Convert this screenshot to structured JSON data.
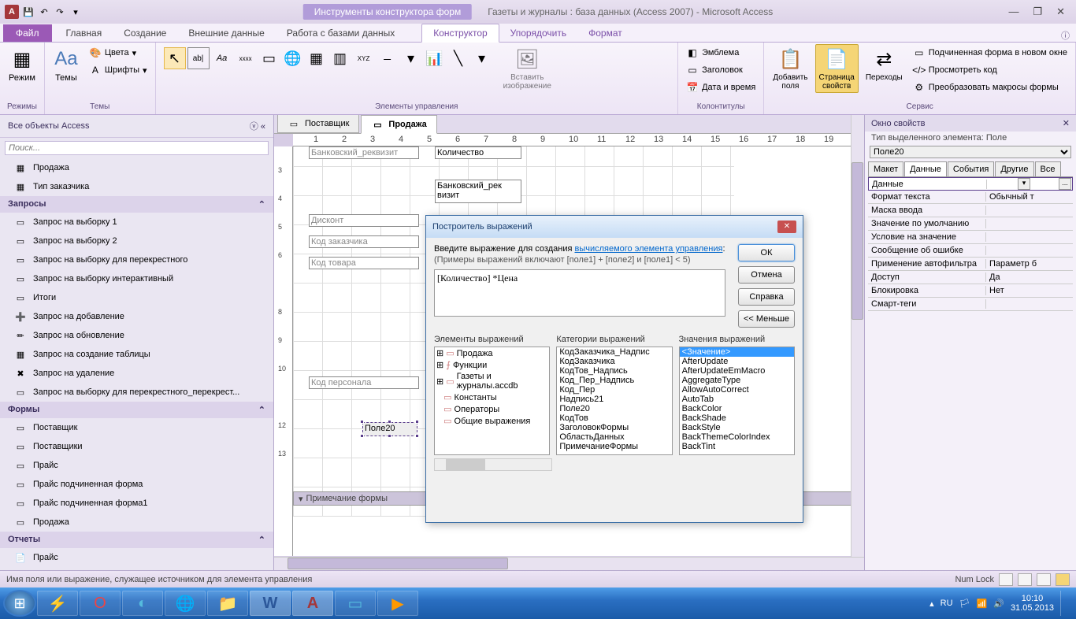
{
  "title_context": "Инструменты конструктора форм",
  "app_title": "Газеты и журналы : база данных (Access 2007)  -  Microsoft Access",
  "file_tab": "Файл",
  "ribbon_tabs": [
    "Главная",
    "Создание",
    "Внешние данные",
    "Работа с базами данных"
  ],
  "ribbon_ctx_tabs": [
    "Конструктор",
    "Упорядочить",
    "Формат"
  ],
  "ribbon_groups": {
    "modes": "Режимы",
    "themes": "Темы",
    "controls": "Элементы управления",
    "headers": "Колонтитулы",
    "tools": "Сервис"
  },
  "ribbon_btn": {
    "regime": "Режим",
    "themes": "Темы",
    "colors": "Цвета",
    "fonts": "Шрифты",
    "insert_img": "Вставить\nизображение",
    "emblem": "Эмблема",
    "title": "Заголовок",
    "datetime": "Дата и время",
    "add_fields": "Добавить\nполя",
    "prop_page": "Страница\nсвойств",
    "transitions": "Переходы",
    "subform": "Подчиненная форма в новом окне",
    "view_code": "Просмотреть код",
    "convert_macros": "Преобразовать макросы формы"
  },
  "nav_header": "Все объекты Access",
  "nav_search_ph": "Поиск...",
  "nav_tables": [
    "Продажа",
    "Тип заказчика"
  ],
  "nav_queries_h": "Запросы",
  "nav_queries": [
    "Запрос на выборку 1",
    "Запрос на выборку 2",
    "Запрос на выборку для перекрестного",
    "Запрос на выборку интерактивный",
    "Итоги",
    "Запрос на добавление",
    "Запрос на обновление",
    "Запрос на создание таблицы",
    "Запрос на удаление",
    "Запрос на выборку для перекрестного_перекрест..."
  ],
  "nav_forms_h": "Формы",
  "nav_forms": [
    "Поставщик",
    "Поставщики",
    "Прайс",
    "Прайс подчиненная форма",
    "Прайс подчиненная форма1",
    "Продажа"
  ],
  "nav_reports_h": "Отчеты",
  "nav_reports": [
    "Прайс"
  ],
  "doc_tabs": [
    "Поставщик",
    "Продажа"
  ],
  "design_fields": {
    "row1a": "Количество",
    "row1b": "Количество",
    "row2a": "Банковский_реквизит",
    "row2b": "Банковский_рек\nвизит",
    "row3a": "Дисконт",
    "row4a": "Код заказчика",
    "row5a": "Код товара",
    "row7a": "Код персонала",
    "sel": "Поле20",
    "footer": "Примечание формы"
  },
  "prop": {
    "title": "Окно свойств",
    "subtitle": "Тип выделенного элемента:  Поле",
    "combo": "Поле20",
    "tabs": [
      "Макет",
      "Данные",
      "События",
      "Другие",
      "Все"
    ],
    "rows": [
      {
        "n": "Данные",
        "v": "",
        "b": "..."
      },
      {
        "n": "Формат текста",
        "v": "Обычный т"
      },
      {
        "n": "Маска ввода",
        "v": ""
      },
      {
        "n": "Значение по умолчанию",
        "v": ""
      },
      {
        "n": "Условие на значение",
        "v": ""
      },
      {
        "n": "Сообщение об ошибке",
        "v": ""
      },
      {
        "n": "Применение автофильтра",
        "v": "Параметр б"
      },
      {
        "n": "Доступ",
        "v": "Да"
      },
      {
        "n": "Блокировка",
        "v": "Нет"
      },
      {
        "n": "Смарт-теги",
        "v": ""
      }
    ]
  },
  "dlg": {
    "title": "Построитель выражений",
    "intro1": "Введите выражение для создания ",
    "intro_link": "вычисляемого элемента управления",
    "intro2": ":",
    "hint": "(Примеры выражений включают [поле1] + [поле2] и [поле1] < 5)",
    "expr": "[Количество] *Цена",
    "ok": "ОК",
    "cancel": "Отмена",
    "help": "Справка",
    "less": "<< Меньше",
    "col_h": [
      "Элементы выражений",
      "Категории выражений",
      "Значения выражений"
    ],
    "tree": [
      "Продажа",
      "Функции",
      "Газеты и журналы.accdb",
      "Константы",
      "Операторы",
      "Общие выражения"
    ],
    "cats": [
      "КодЗаказчика_Надпис",
      "КодЗаказчика",
      "КодТов_Надпись",
      "Код_Пер_Надпись",
      "Код_Пер",
      "Надпись21",
      "Поле20",
      "КодТов",
      "ЗаголовокФормы",
      "ОбластьДанных",
      "ПримечаниеФормы"
    ],
    "vals": [
      "<Значение>",
      "AfterUpdate",
      "AfterUpdateEmMacro",
      "AggregateType",
      "AllowAutoCorrect",
      "AutoTab",
      "BackColor",
      "BackShade",
      "BackStyle",
      "BackThemeColorIndex",
      "BackTint"
    ]
  },
  "statusbar": "Имя поля или выражение, служащее источником для элемента управления",
  "status_numlock": "Num Lock",
  "tray": {
    "lang": "RU",
    "time": "10:10",
    "date": "31.05.2013"
  }
}
